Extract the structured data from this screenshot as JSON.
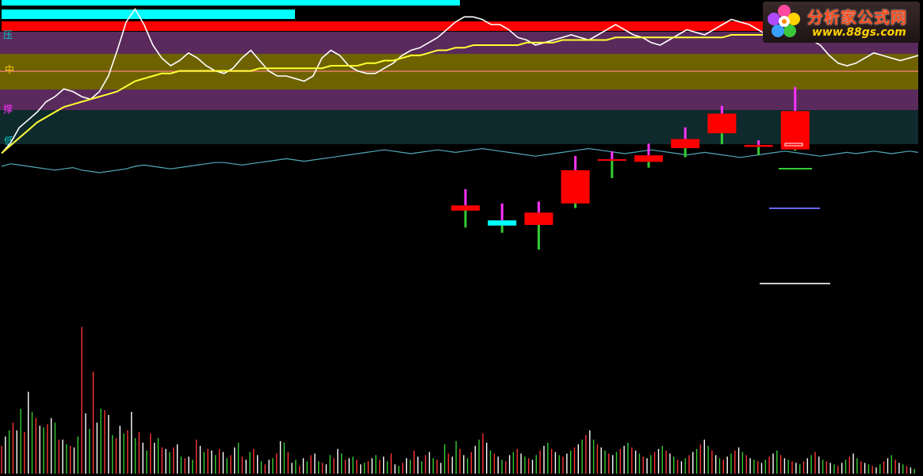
{
  "chart_data": {
    "type": "candlestick",
    "band_labels": {
      "top": "压",
      "mid": "中",
      "support": "撑",
      "bottom": "低"
    },
    "logo": {
      "title": "分析家公式网",
      "url": "www.88gs.com"
    },
    "colors": {
      "up": "#ff0000",
      "down": "#00ffff",
      "wick_up": "#ff33ff",
      "wick_down": "#33cc33",
      "price_line": "#ffffff",
      "ma_line": "#ffff33",
      "lower_line": "#4fa8b8",
      "band_purple": "#5a2a5c",
      "band_olive": "#6e6200",
      "band_dark": "#0e2a2c",
      "mid_line": "#c87850",
      "bar_red": "#ff0000",
      "bar_cyan": "#00ffff"
    },
    "top_bars": [
      {
        "name": "bar-cyan-1",
        "color": "#00ffff",
        "length": 0.5
      },
      {
        "name": "bar-cyan-2",
        "color": "#00ffff",
        "length": 0.32
      },
      {
        "name": "bar-red",
        "color": "#ff0000",
        "length": 1.0
      }
    ],
    "candles": [
      {
        "open": 95.8,
        "close": 96.6,
        "high": 99.1,
        "low": 93.2
      },
      {
        "open": 94.3,
        "close": 93.5,
        "high": 96.9,
        "low": 92.4
      },
      {
        "open": 93.6,
        "close": 95.5,
        "high": 97.2,
        "low": 89.8
      },
      {
        "open": 96.9,
        "close": 102.0,
        "high": 104.2,
        "low": 96.2
      },
      {
        "open": 103.6,
        "close": 103.7,
        "high": 104.9,
        "low": 100.8
      },
      {
        "open": 103.3,
        "close": 104.3,
        "high": 106.1,
        "low": 102.4
      },
      {
        "open": 105.4,
        "close": 106.8,
        "high": 108.6,
        "low": 104.0
      },
      {
        "open": 107.7,
        "close": 110.7,
        "high": 111.9,
        "low": 106.0
      },
      {
        "open": 105.6,
        "close": 105.9,
        "high": 106.6,
        "low": 104.3
      },
      {
        "open": 105.2,
        "close": 111.1,
        "high": 114.8,
        "low": 105.0
      }
    ],
    "price_line": [
      120,
      124,
      130,
      133,
      136,
      140,
      142,
      145,
      144,
      142,
      141,
      144,
      150,
      160,
      171,
      176,
      170,
      162,
      157,
      154,
      156,
      159,
      157,
      154,
      152,
      151,
      153,
      157,
      160,
      156,
      152,
      150,
      150,
      149,
      148,
      150,
      157,
      160,
      158,
      154,
      152,
      151,
      151,
      153,
      155,
      158,
      160,
      161,
      163,
      165,
      168,
      171,
      173,
      173,
      172,
      170,
      170,
      168,
      165,
      164,
      162,
      163,
      164,
      165,
      166,
      165,
      164,
      166,
      168,
      170,
      168,
      166,
      165,
      163,
      162,
      164,
      166,
      168,
      167,
      166,
      168,
      170,
      172,
      171,
      170,
      168,
      166,
      167,
      169,
      168,
      166,
      164,
      162,
      158,
      155,
      154,
      155,
      157,
      159,
      158,
      157,
      156,
      157,
      158
    ],
    "ma_line": [
      120,
      123,
      126,
      129,
      132,
      134,
      136,
      138,
      139,
      140,
      141,
      142,
      143,
      144,
      146,
      148,
      149,
      150,
      151,
      151,
      152,
      152,
      152,
      152,
      152,
      152,
      152,
      152,
      152,
      153,
      153,
      153,
      153,
      153,
      153,
      153,
      153,
      154,
      154,
      154,
      154,
      155,
      155,
      156,
      156,
      157,
      158,
      158,
      159,
      160,
      160,
      161,
      161,
      162,
      162,
      162,
      162,
      162,
      162,
      163,
      163,
      163,
      163,
      164,
      164,
      164,
      164,
      164,
      164,
      165,
      165,
      165,
      165,
      165,
      165,
      165,
      165,
      165,
      165,
      165,
      165,
      165,
      166,
      166,
      166,
      166,
      166,
      166,
      166,
      166,
      166,
      166,
      166,
      166,
      166,
      166,
      166,
      166,
      166,
      166,
      166,
      166,
      166,
      166
    ],
    "lower_line": [
      0,
      2,
      1,
      0,
      -1,
      -2,
      -3,
      -2,
      -1,
      -3,
      -4,
      -5,
      -4,
      -3,
      -2,
      0,
      1,
      0,
      -1,
      -2,
      -1,
      0,
      1,
      2,
      3,
      3,
      2,
      1,
      2,
      3,
      4,
      5,
      6,
      5,
      4,
      5,
      6,
      7,
      8,
      9,
      10,
      11,
      12,
      13,
      12,
      11,
      10,
      11,
      12,
      13,
      12,
      11,
      12,
      13,
      14,
      13,
      12,
      11,
      10,
      9,
      8,
      9,
      10,
      11,
      12,
      13,
      14,
      13,
      12,
      11,
      10,
      11,
      12,
      13,
      12,
      11,
      10,
      9,
      10,
      11,
      10,
      9,
      8,
      7,
      8,
      9,
      10,
      11,
      12,
      11,
      10,
      9,
      8,
      9,
      10,
      11,
      10,
      11,
      12,
      11,
      10,
      11,
      12,
      11
    ],
    "volume": [
      18,
      24,
      28,
      33,
      28,
      42,
      27,
      53,
      40,
      36,
      31,
      30,
      32,
      36,
      33,
      22,
      22,
      19,
      18,
      17,
      24,
      95,
      39,
      29,
      66,
      33,
      42,
      41,
      38,
      25,
      23,
      31,
      26,
      28,
      40,
      23,
      27,
      20,
      15,
      26,
      20,
      23,
      17,
      16,
      14,
      17,
      19,
      11,
      10,
      11,
      9,
      22,
      18,
      14,
      16,
      15,
      12,
      16,
      14,
      10,
      12,
      17,
      20,
      11,
      9,
      14,
      16,
      12,
      8,
      6,
      9,
      10,
      13,
      21,
      20,
      14,
      7,
      9,
      5,
      10,
      8,
      12,
      13,
      8,
      7,
      6,
      12,
      10,
      16,
      13,
      9,
      10,
      11,
      9,
      6,
      7,
      8,
      10,
      12,
      9,
      11,
      8,
      13,
      6,
      5,
      7,
      10,
      9,
      15,
      11,
      8,
      12,
      14,
      10,
      9,
      7,
      19,
      13,
      11,
      21,
      16,
      12,
      10,
      14,
      18,
      22,
      26,
      20,
      15,
      13,
      11,
      9,
      8,
      12,
      14,
      16,
      13,
      11,
      10,
      9,
      12,
      15,
      18,
      20,
      16,
      14,
      12,
      11,
      13,
      15,
      17,
      19,
      22,
      25,
      28,
      22,
      19,
      17,
      15,
      13,
      12,
      14,
      16,
      18,
      20,
      17,
      15,
      13,
      11,
      10,
      12,
      14,
      16,
      18,
      15,
      13,
      11,
      9,
      8,
      10,
      12,
      14,
      16,
      19,
      22,
      18,
      15,
      12,
      10,
      9,
      11,
      13,
      15,
      17,
      14,
      12,
      10,
      9,
      8,
      7,
      9,
      11,
      13,
      15,
      12,
      10,
      9,
      8,
      7,
      6,
      8,
      10,
      12,
      14,
      11,
      9,
      8,
      7,
      6,
      5,
      7,
      9,
      11,
      13,
      10,
      8,
      7,
      6,
      5,
      4,
      6,
      8,
      10,
      12,
      9,
      7,
      6,
      5,
      4,
      3
    ],
    "volume_colors_cycle": [
      "#ff3333",
      "#33cc33",
      "#ffffff"
    ]
  }
}
